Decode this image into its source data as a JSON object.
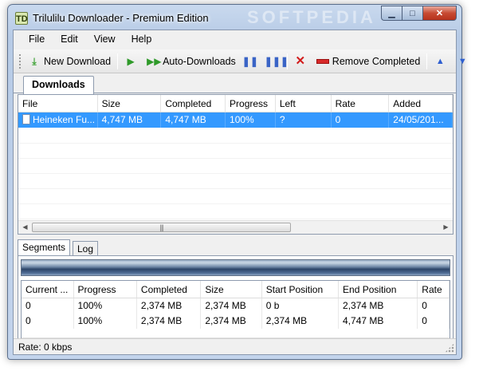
{
  "window": {
    "title": "Trilulilu Downloader - Premium Edition",
    "app_icon_glyph": "TD",
    "watermark": "SOFTPEDIA"
  },
  "menu": [
    "File",
    "Edit",
    "View",
    "Help"
  ],
  "toolbar": {
    "new_download": "New Download",
    "auto_downloads": "Auto-Downloads",
    "remove_completed": "Remove Completed"
  },
  "main_tabs": [
    "Downloads"
  ],
  "downloads": {
    "columns": [
      "File",
      "Size",
      "Completed",
      "Progress",
      "Left",
      "Rate",
      "Added"
    ],
    "rows": [
      {
        "file": "Heineken Fu...",
        "size": "4,747 MB",
        "completed": "4,747 MB",
        "progress": "100%",
        "left": "?",
        "rate": "0",
        "added": "24/05/201..."
      }
    ]
  },
  "detail_tabs": [
    "Segments",
    "Log"
  ],
  "segments": {
    "progress_fraction": 1.0,
    "columns": [
      "Current ...",
      "Progress",
      "Completed",
      "Size",
      "Start Position",
      "End Position",
      "Rate"
    ],
    "rows": [
      {
        "current": "0",
        "progress": "100%",
        "completed": "2,374 MB",
        "size": "2,374 MB",
        "start": "0 b",
        "end": "2,374 MB",
        "rate": "0"
      },
      {
        "current": "0",
        "progress": "100%",
        "completed": "2,374 MB",
        "size": "2,374 MB",
        "start": "2,374 MB",
        "end": "4,747 MB",
        "rate": "0"
      }
    ]
  },
  "status": {
    "rate_label": "Rate:",
    "rate_value": "0 kbps"
  },
  "colors": {
    "selection": "#3399ff",
    "close_button": "#c74a32"
  }
}
